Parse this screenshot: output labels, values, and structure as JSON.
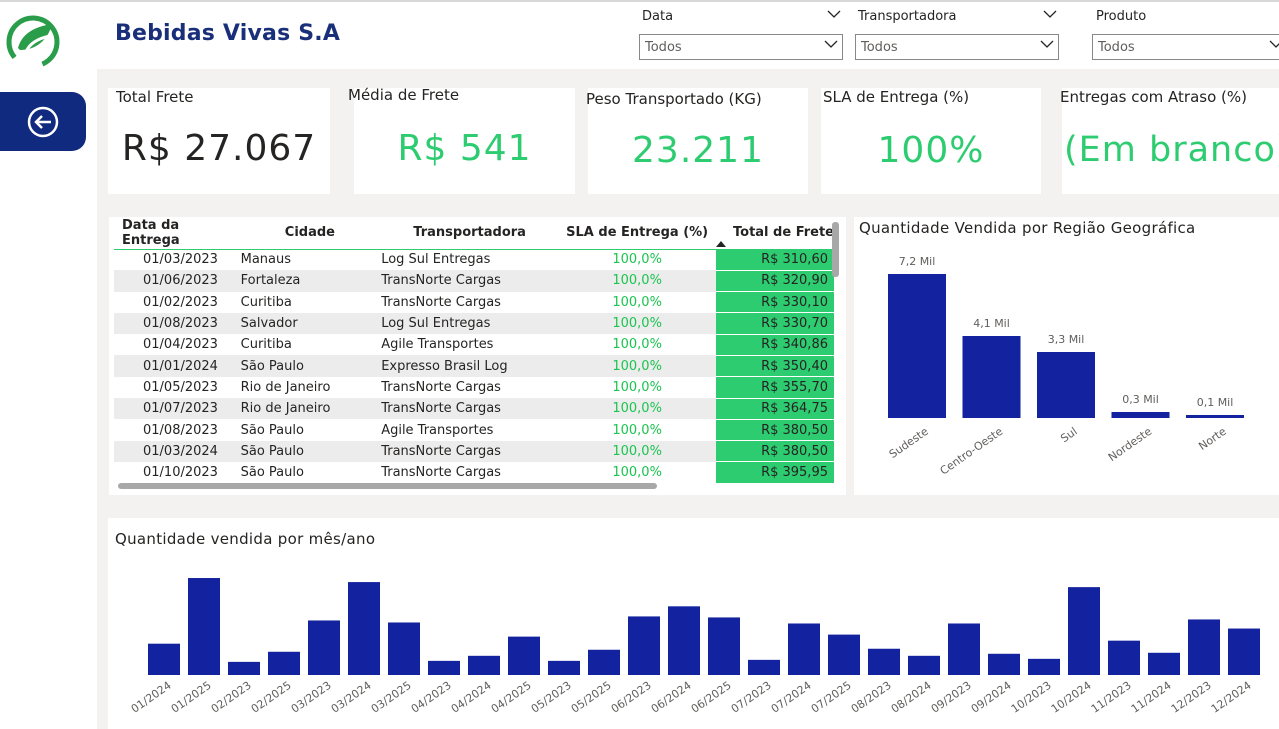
{
  "company": "Bebidas Vivas S.A",
  "filters": [
    {
      "label": "Data",
      "value": "Todos"
    },
    {
      "label": "Transportadora",
      "value": "Todos"
    },
    {
      "label": "Produto",
      "value": "Todos"
    }
  ],
  "kpis": [
    {
      "title": "Total Frete",
      "value": "R$ 27.067",
      "color": "#252423"
    },
    {
      "title": "Média de Frete",
      "value": "R$ 541",
      "color": "#2ecc71"
    },
    {
      "title": "Peso Transportado (KG)",
      "value": "23.211",
      "color": "#2ecc71"
    },
    {
      "title": "SLA de Entrega (%)",
      "value": "100%",
      "color": "#2ecc71"
    },
    {
      "title": "Entregas com Atraso (%)",
      "value": "(Em branco)",
      "color": "#2ecc71"
    }
  ],
  "table": {
    "columns": [
      "Data da Entrega",
      "Cidade",
      "Transportadora",
      "SLA de Entrega (%)",
      "Total de Frete"
    ],
    "rows": [
      [
        "01/03/2023",
        "Manaus",
        "Log Sul Entregas",
        "100,0%",
        "R$ 310,60"
      ],
      [
        "01/06/2023",
        "Fortaleza",
        "TransNorte Cargas",
        "100,0%",
        "R$ 320,90"
      ],
      [
        "01/02/2023",
        "Curitiba",
        "TransNorte Cargas",
        "100,0%",
        "R$ 330,10"
      ],
      [
        "01/08/2023",
        "Salvador",
        "Log Sul Entregas",
        "100,0%",
        "R$ 330,70"
      ],
      [
        "01/04/2023",
        "Curitiba",
        "Agile Transportes",
        "100,0%",
        "R$ 340,86"
      ],
      [
        "01/01/2024",
        "São Paulo",
        "Expresso Brasil Log",
        "100,0%",
        "R$ 350,40"
      ],
      [
        "01/05/2023",
        "Rio de Janeiro",
        "TransNorte Cargas",
        "100,0%",
        "R$ 355,70"
      ],
      [
        "01/07/2023",
        "Rio de Janeiro",
        "TransNorte Cargas",
        "100,0%",
        "R$ 364,75"
      ],
      [
        "01/08/2023",
        "São Paulo",
        "Agile Transportes",
        "100,0%",
        "R$ 380,50"
      ],
      [
        "01/03/2024",
        "São Paulo",
        "TransNorte Cargas",
        "100,0%",
        "R$ 380,50"
      ],
      [
        "01/10/2023",
        "São Paulo",
        "TransNorte Cargas",
        "100,0%",
        "R$ 395,95"
      ]
    ]
  },
  "colors": {
    "bar": "#13229e",
    "accent_green": "#2ecc71",
    "brand": "#0f2a7e"
  },
  "chart_data": [
    {
      "type": "bar",
      "title": "Quantidade Vendida por Região Geográfica",
      "categories": [
        "Sudeste",
        "Centro-Oeste",
        "Sul",
        "Nordeste",
        "Norte"
      ],
      "values": [
        7.2,
        4.1,
        3.3,
        0.3,
        0.1
      ],
      "labels": [
        "7,2 Mil",
        "4,1 Mil",
        "3,3 Mil",
        "0,3 Mil",
        "0,1 Mil"
      ],
      "ylim": [
        0,
        8
      ]
    },
    {
      "type": "bar",
      "title": "Quantidade vendida por mês/ano",
      "categories": [
        "01/2024",
        "01/2025",
        "02/2023",
        "02/2025",
        "03/2023",
        "03/2024",
        "03/2025",
        "04/2023",
        "04/2024",
        "04/2025",
        "05/2023",
        "05/2025",
        "06/2023",
        "06/2024",
        "06/2025",
        "07/2023",
        "07/2024",
        "07/2025",
        "08/2023",
        "08/2024",
        "09/2023",
        "09/2024",
        "10/2023",
        "10/2024",
        "11/2023",
        "11/2024",
        "12/2023",
        "12/2024"
      ],
      "values": [
        310,
        960,
        130,
        230,
        540,
        920,
        520,
        140,
        190,
        380,
        140,
        250,
        580,
        680,
        570,
        150,
        510,
        400,
        260,
        190,
        510,
        210,
        160,
        870,
        340,
        220,
        550,
        460
      ],
      "ylim": [
        0,
        1000
      ]
    }
  ]
}
